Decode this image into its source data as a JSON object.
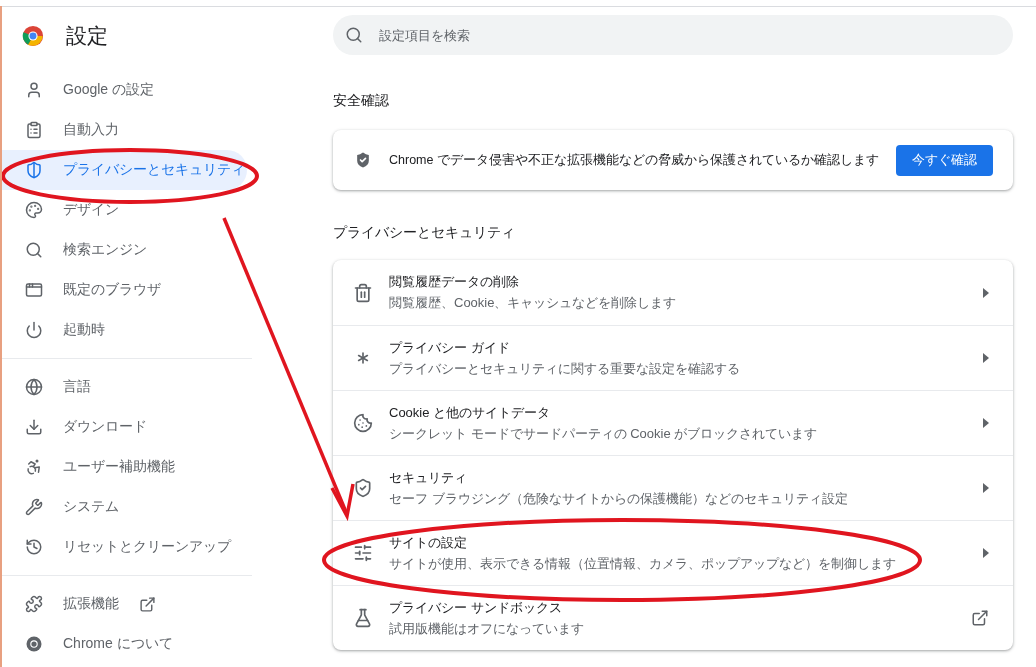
{
  "sidebar": {
    "title": "設定",
    "groups": [
      {
        "items": [
          {
            "label": "Google の設定",
            "kind": "page",
            "selected": false
          },
          {
            "label": "自動入力",
            "kind": "page",
            "selected": false
          },
          {
            "label": "プライバシーとセキュリティ",
            "kind": "page",
            "selected": true
          },
          {
            "label": "デザイン",
            "kind": "page",
            "selected": false
          },
          {
            "label": "検索エンジン",
            "kind": "page",
            "selected": false
          },
          {
            "label": "既定のブラウザ",
            "kind": "page",
            "selected": false
          },
          {
            "label": "起動時",
            "kind": "page",
            "selected": false
          }
        ]
      },
      {
        "items": [
          {
            "label": "言語",
            "kind": "page",
            "selected": false
          },
          {
            "label": "ダウンロード",
            "kind": "page",
            "selected": false
          },
          {
            "label": "ユーザー補助機能",
            "kind": "page",
            "selected": false
          },
          {
            "label": "システム",
            "kind": "page",
            "selected": false
          },
          {
            "label": "リセットとクリーンアップ",
            "kind": "page",
            "selected": false
          }
        ]
      },
      {
        "items": [
          {
            "label": "拡張機能",
            "kind": "external",
            "selected": false
          },
          {
            "label": "Chrome について",
            "kind": "page",
            "selected": false
          }
        ]
      }
    ]
  },
  "search": {
    "placeholder": "設定項目を検索"
  },
  "safety_check": {
    "heading": "安全確認",
    "text": "Chrome でデータ侵害や不正な拡張機能などの脅威から保護されているか確認します",
    "button": "今すぐ確認"
  },
  "privacy": {
    "heading": "プライバシーとセキュリティ",
    "rows": [
      {
        "title": "閲覧履歴データの削除",
        "subtitle": "閲覧履歴、Cookie、キャッシュなどを削除します",
        "kind": "arrow"
      },
      {
        "title": "プライバシー ガイド",
        "subtitle": "プライバシーとセキュリティに関する重要な設定を確認する",
        "kind": "arrow"
      },
      {
        "title": "Cookie と他のサイトデータ",
        "subtitle": "シークレット モードでサードパーティの Cookie がブロックされています",
        "kind": "arrow"
      },
      {
        "title": "セキュリティ",
        "subtitle": "セーフ ブラウジング（危険なサイトからの保護機能）などのセキュリティ設定",
        "kind": "arrow"
      },
      {
        "title": "サイトの設定",
        "subtitle": "サイトが使用、表示できる情報（位置情報、カメラ、ポップアップなど）を制御します",
        "kind": "arrow"
      },
      {
        "title": "プライバシー サンドボックス",
        "subtitle": "試用版機能はオフになっています",
        "kind": "external"
      }
    ]
  }
}
